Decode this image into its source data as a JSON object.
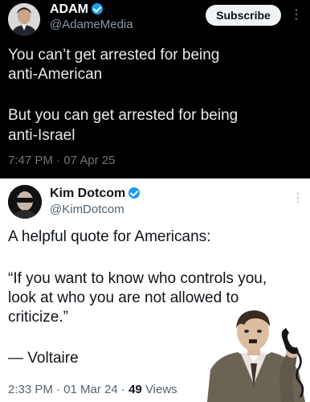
{
  "tweet1": {
    "name": "ADAM",
    "handle": "@AdameMedia",
    "subscribe_label": "Subscribe",
    "more_icon": "more-vertical-icon",
    "lines": [
      "You can’t get arrested for being",
      "anti-American",
      "But you can get arrested for being",
      "anti-Israel"
    ],
    "timestamp": "7:47 PM · 07 Apr 25"
  },
  "tweet2": {
    "name": "Kim Dotcom",
    "handle": "@KimDotcom",
    "more_icon": "more-vertical-icon",
    "lines": [
      "A helpful quote for Americans:",
      "“If you want to know who controls you,",
      "look at who you are not allowed to",
      "criticize.”",
      "— Voltaire"
    ],
    "time_date": "2:33 PM · 01 Mar 24 ·",
    "views_count": "49",
    "views_label": "Views"
  },
  "colors": {
    "verified": "#1d9bf0",
    "dark_bg": "#000000",
    "light_bg": "#ffffff"
  }
}
